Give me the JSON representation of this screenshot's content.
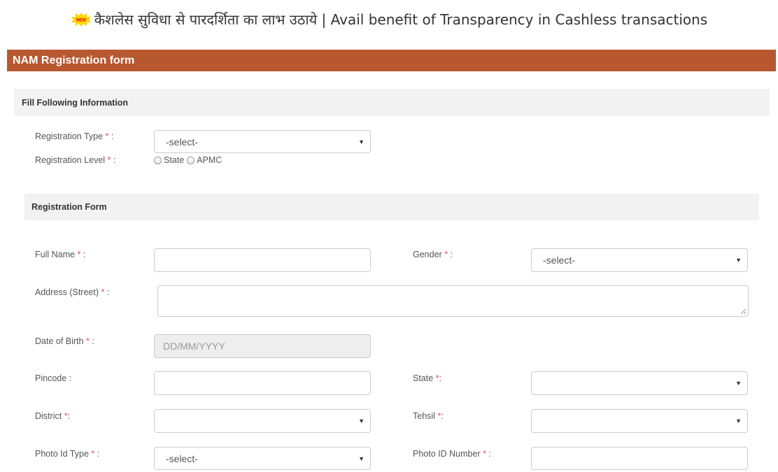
{
  "banner": {
    "badge": "NEW",
    "text": "कैशलेस सुविधा से पारदर्शिता का लाभ उठाये | Avail benefit of Transparency in Cashless transactions"
  },
  "header": {
    "title": "NAM Registration form"
  },
  "info_section": {
    "title": "Fill Following Information",
    "registration_type": {
      "label": "Registration Type",
      "value": "-select-"
    },
    "registration_level": {
      "label": "Registration Level",
      "options": [
        "State",
        "APMC"
      ]
    }
  },
  "form_section": {
    "title": "Registration Form"
  },
  "form": {
    "full_name": {
      "label": "Full Name",
      "value": ""
    },
    "gender": {
      "label": "Gender",
      "value": "-select-"
    },
    "address": {
      "label": "Address (Street)",
      "value": ""
    },
    "dob": {
      "label": "Date of Birth",
      "placeholder": "DD/MM/YYYY"
    },
    "pincode": {
      "label": "Pincode",
      "value": ""
    },
    "state": {
      "label": "State",
      "value": ""
    },
    "district": {
      "label": "District",
      "value": ""
    },
    "tehsil": {
      "label": "Tehsil",
      "value": ""
    },
    "photo_id_type": {
      "label": "Photo Id Type",
      "value": "-select-"
    },
    "photo_id_number": {
      "label": "Photo ID Number",
      "value": ""
    }
  },
  "common": {
    "required_mark": "*",
    "colon": " :",
    "colon_tight": ":"
  },
  "colors": {
    "header_bg": "#b75831",
    "section_bg": "#f2f2f2",
    "required": "#d9534f"
  }
}
